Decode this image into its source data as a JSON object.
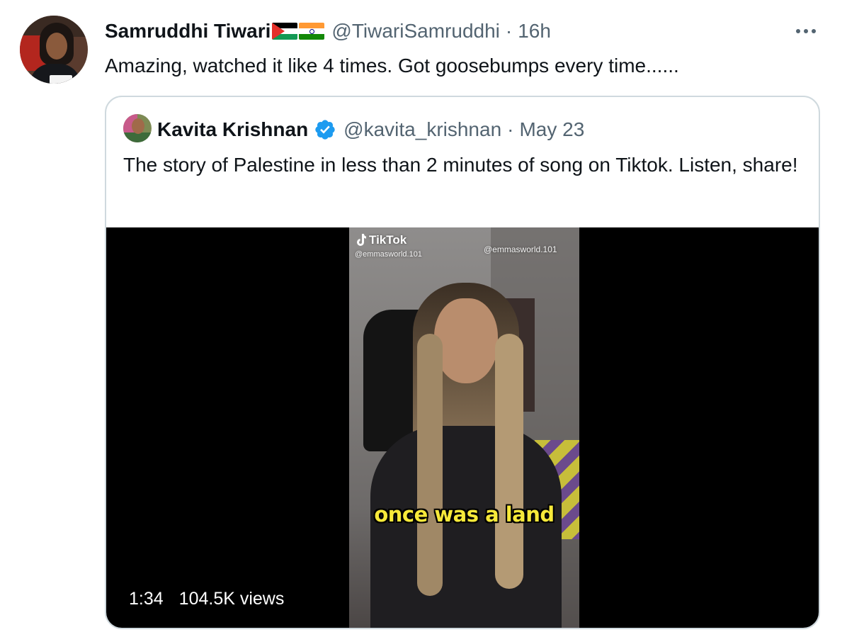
{
  "tweet": {
    "display_name": "Samruddhi Tiwari",
    "flags": [
      "palestine-flag",
      "india-flag"
    ],
    "handle": "@TiwariSamruddhi",
    "separator": "·",
    "time": "16h",
    "text": "Amazing, watched it like 4 times. Got goosebumps every time......"
  },
  "quoted_tweet": {
    "display_name": "Kavita Krishnan",
    "verified": true,
    "handle": "@kavita_krishnan",
    "separator": "·",
    "date": "May 23",
    "text": "The story of Palestine in less than 2 minutes of song on Tiktok. Listen, share!"
  },
  "video": {
    "watermark_brand": "TikTok",
    "watermark_user_top_left": "@emmasworld.101",
    "watermark_user_top_right": "@emmasworld.101",
    "caption": "once was a land",
    "duration": "1:34",
    "views": "104.5K views"
  },
  "colors": {
    "text_primary": "#0f1419",
    "text_secondary": "#536471",
    "border": "#cfd9de",
    "verified_blue": "#1d9bf0",
    "caption_yellow": "#f7e93a"
  }
}
